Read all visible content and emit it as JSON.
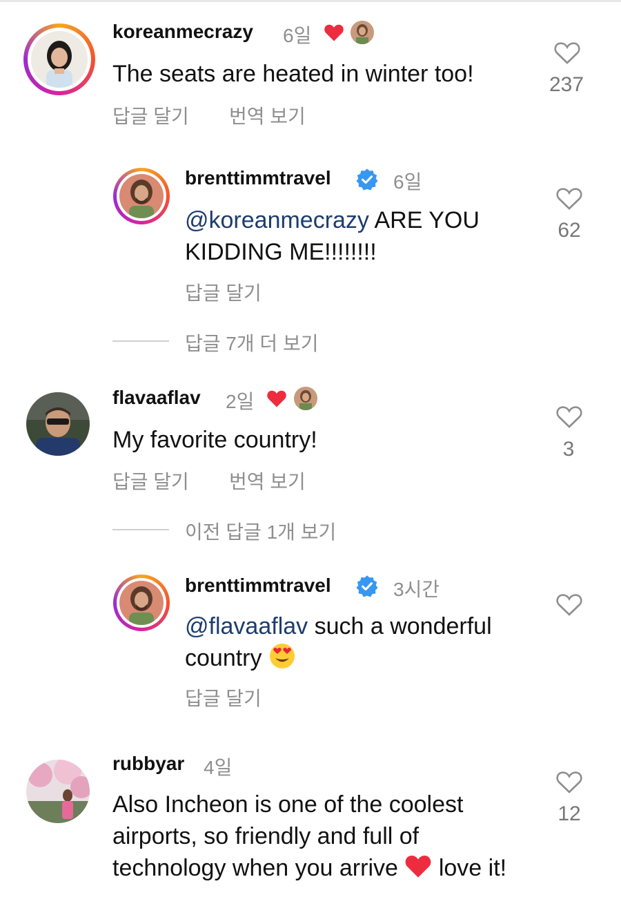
{
  "comments": [
    {
      "username": "koreanmecrazy",
      "time": "6일",
      "text": "The seats are heated in winter too!",
      "like_count": "237",
      "reply_label": "답글 달기",
      "translate_label": "번역 보기"
    },
    {
      "username": "brenttimmtravel",
      "time": "6일",
      "mention": "@koreanmecrazy",
      "text": " ARE YOU KIDDING ME!!!!!!!!",
      "like_count": "62",
      "reply_label": "답글 달기"
    },
    {
      "username": "flavaaflav",
      "time": "2일",
      "text": "My favorite country!",
      "like_count": "3",
      "reply_label": "답글 달기",
      "translate_label": "번역 보기"
    },
    {
      "username": "brenttimmtravel",
      "time": "3시간",
      "mention": "@flavaaflav",
      "text": " such a wonderful country",
      "like_count": "",
      "reply_label": "답글 달기"
    },
    {
      "username": "rubbyar",
      "time": "4일",
      "text_a": "Also Incheon is one of the coolest airports, so friendly and full of technology when you arrive",
      "text_b": " love it!",
      "like_count": "12"
    }
  ],
  "more_replies_1": "답글 7개 더 보기",
  "previous_replies_2": "이전 답글 1개 보기",
  "colors": {
    "heart": "#ed2d3f",
    "verified": "#3897f0",
    "mention": "#1c3c6e",
    "muted": "#8e8e8e"
  },
  "icons": [
    "heart-outline-icon",
    "heart-filled-icon",
    "verified-badge-icon",
    "heart-eyes-emoji"
  ]
}
